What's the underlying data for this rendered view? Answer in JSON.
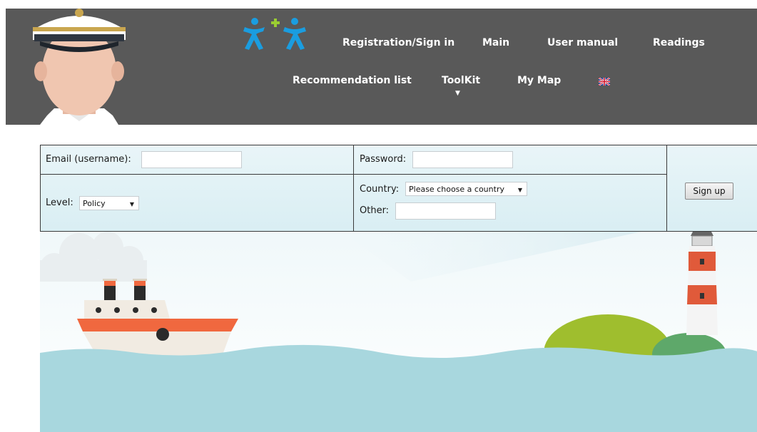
{
  "header": {
    "nav": {
      "registration": "Registration/Sign in",
      "main": "Main",
      "user_manual": "User manual",
      "readings": "Readings",
      "recommendation_list": "Recommendation list",
      "toolkit": "ToolKit",
      "toolkit_arrow": "▼",
      "my_map": "My Map"
    },
    "colors": {
      "background": "#595959",
      "logo_blue": "#1a9de0",
      "logo_green": "#9acd32"
    }
  },
  "form": {
    "email_label": "Email (username):",
    "email_value": "",
    "password_label": "Password:",
    "password_value": "",
    "level_label": "Level:",
    "level_selected": "Policy",
    "country_label": "Country:",
    "country_selected": "Please choose a country",
    "other_label": "Other:",
    "other_value": "",
    "signup_label": "Sign up"
  },
  "scene": {
    "colors": {
      "sea": "#a8d7de",
      "hill": "#9fbe2e",
      "lighthouse_red": "#e05a3a",
      "ship_orange": "#f0683f"
    }
  }
}
